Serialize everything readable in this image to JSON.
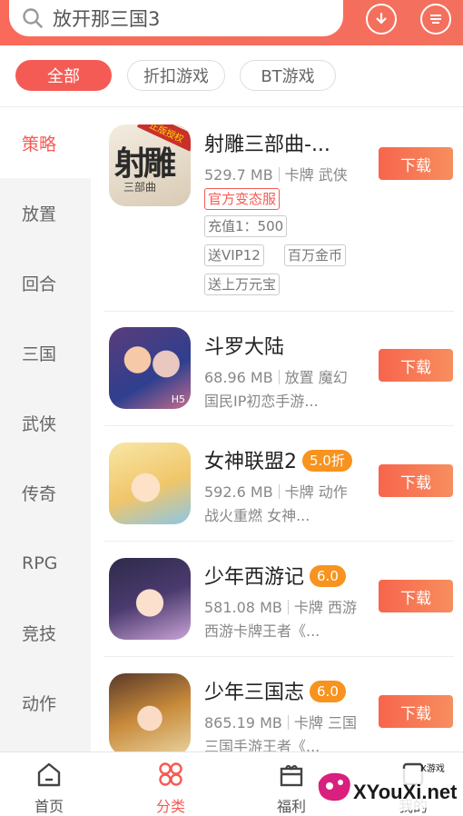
{
  "search": {
    "text": "放开那三国3"
  },
  "header_icons": [
    "download-icon",
    "message-icon"
  ],
  "filters": [
    {
      "label": "全部",
      "active": true
    },
    {
      "label": "折扣游戏",
      "active": false
    },
    {
      "label": "BT游戏",
      "active": false
    }
  ],
  "categories": [
    {
      "label": "策略",
      "active": true
    },
    {
      "label": "放置"
    },
    {
      "label": "回合"
    },
    {
      "label": "三国"
    },
    {
      "label": "武侠"
    },
    {
      "label": "传奇"
    },
    {
      "label": "RPG"
    },
    {
      "label": "竞技"
    },
    {
      "label": "动作"
    }
  ],
  "games": [
    {
      "name": "射雕三部曲-...",
      "size": "529.7 MB",
      "genre": "卡牌 武侠",
      "tags": [
        "官方变态服",
        "充值1：500",
        "送VIP12",
        "百万金币",
        "送上万元宝"
      ],
      "icon_text": "射雕",
      "icon_subtext": "三部曲",
      "icon_banner": "正版授权",
      "button": "下载"
    },
    {
      "name": "斗罗大陆",
      "size": "68.96 MB",
      "genre": "放置 魔幻",
      "desc": "国民IP初恋手游...",
      "icon_text": "H5",
      "button": "下载"
    },
    {
      "name": "女神联盟2",
      "badge": "5.0折",
      "size": "592.6 MB",
      "genre": "卡牌 动作",
      "desc": "战火重燃 女神...",
      "button": "下载"
    },
    {
      "name": "少年西游记",
      "badge": "6.0",
      "size": "581.08 MB",
      "genre": "卡牌 西游",
      "desc": "西游卡牌王者《...",
      "button": "下载"
    },
    {
      "name": "少年三国志",
      "badge": "6.0",
      "size": "865.19 MB",
      "genre": "卡牌 三国",
      "desc": "三国手游王者《...",
      "button": "下载"
    }
  ],
  "nav": [
    {
      "label": "首页",
      "icon": "home-icon"
    },
    {
      "label": "分类",
      "icon": "category-icon",
      "active": true
    },
    {
      "label": "福利",
      "icon": "gift-icon"
    },
    {
      "label": "我的",
      "icon": "user-icon"
    }
  ],
  "watermark": {
    "text": "XYouXi.net",
    "small": "X游戏"
  }
}
